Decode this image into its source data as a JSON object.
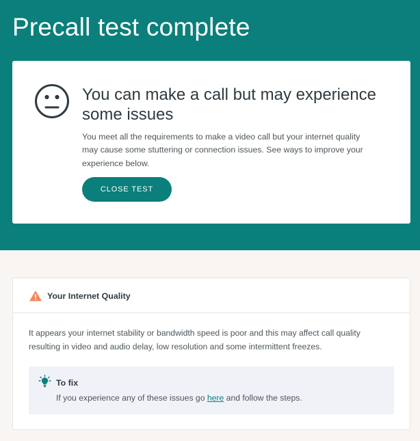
{
  "page": {
    "title": "Precall test complete"
  },
  "result": {
    "icon": "neutral-face-icon",
    "heading": "You can make a call but may experience some issues",
    "description": "You meet all the requirements to make a video call but your internet quality may cause some stuttering or connection issues. See ways to improve your experience below.",
    "close_button_label": "CLOSE TEST"
  },
  "internet_quality": {
    "icon": "warning-icon",
    "title": "Your Internet Quality",
    "description": "It appears your internet stability or bandwidth speed is poor and this may affect call quality resulting in video and audio delay, low resolution and some intermittent freezes.",
    "fix": {
      "icon": "lightbulb-icon",
      "title": "To fix",
      "text_before_link": "If you experience any of these issues go ",
      "link_text": "here",
      "text_after_link": " and follow the steps."
    }
  },
  "colors": {
    "brand_teal": "#0b7f7b",
    "page_background": "#f8f5f2",
    "warning_orange": "#f3875a",
    "fix_box_background": "#f1f2f8"
  }
}
